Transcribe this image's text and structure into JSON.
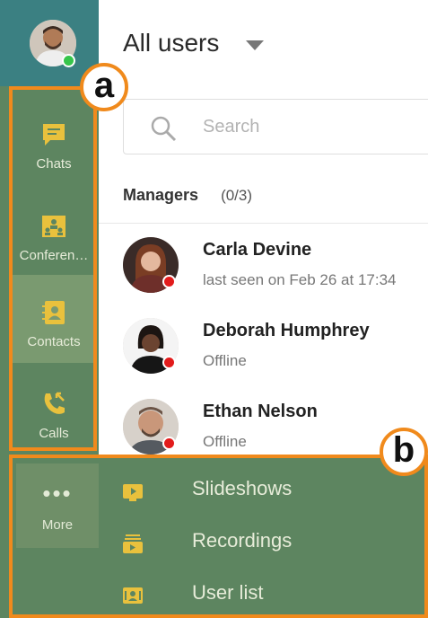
{
  "header": {
    "title": "All users"
  },
  "search": {
    "placeholder": "Search"
  },
  "sidebar": {
    "items": [
      {
        "label": "Chats",
        "icon": "chat-icon"
      },
      {
        "label": "Conferen…",
        "icon": "conference-icon"
      },
      {
        "label": "Contacts",
        "icon": "contacts-icon"
      },
      {
        "label": "Calls",
        "icon": "calls-icon"
      }
    ],
    "more": {
      "label": "More",
      "icon": "more-dots-icon",
      "dots": "•••"
    }
  },
  "section": {
    "title": "Managers",
    "count": "(0/3)"
  },
  "users": [
    {
      "name": "Carla Devine",
      "status": "last seen on Feb 26 at 17:34"
    },
    {
      "name": "Deborah Humphrey",
      "status": "Offline"
    },
    {
      "name": "Ethan Nelson",
      "status": "Offline"
    }
  ],
  "more_menu": {
    "items": [
      {
        "label": "Slideshows",
        "icon": "slideshow-icon"
      },
      {
        "label": "Recordings",
        "icon": "recordings-icon"
      },
      {
        "label": "User list",
        "icon": "user-list-icon"
      }
    ]
  },
  "annotations": {
    "a": "a",
    "b": "b"
  },
  "colors": {
    "sidebar": "#5d8560",
    "sidebar_top": "#3b8082",
    "accent_orange": "#f08a1c",
    "online": "#36c54a",
    "offline": "#e21b1b"
  }
}
